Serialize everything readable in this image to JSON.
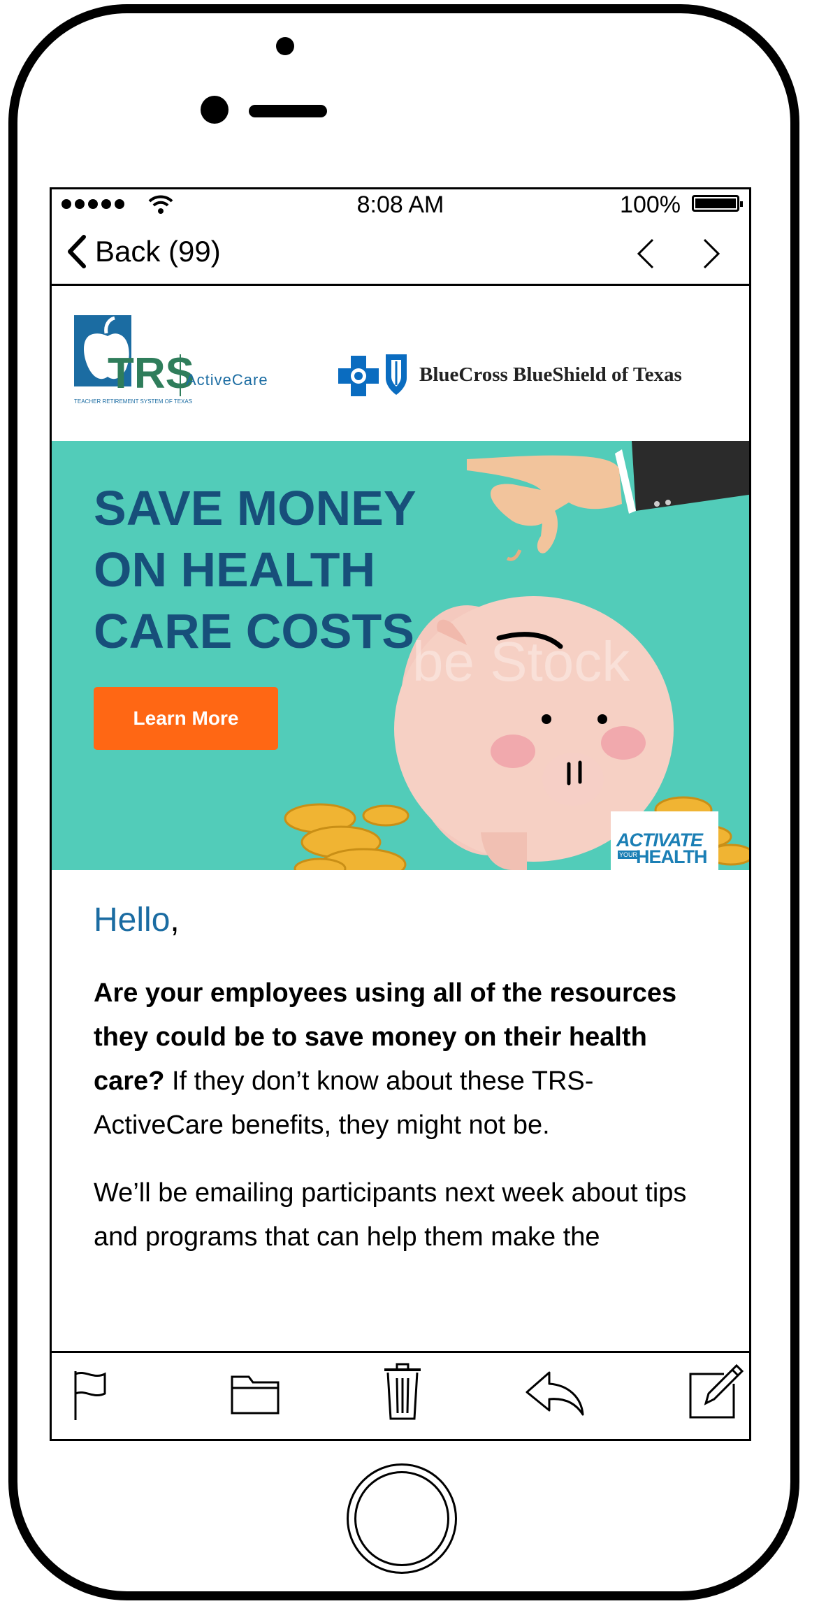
{
  "status_bar": {
    "time": "8:08 AM",
    "battery_percent": "100%",
    "signal_bars": 5
  },
  "nav": {
    "back_label": "Back (99)",
    "prev_icon": "chevron-left-icon",
    "next_icon": "chevron-right-icon"
  },
  "email": {
    "logos": {
      "trs_mark": "TRS",
      "trs_product": "ActiveCare",
      "trs_tagline": "TEACHER RETIREMENT SYSTEM OF TEXAS",
      "partner_name": "BlueCross BlueShield of Texas"
    },
    "banner": {
      "headline_lines": [
        "SAVE MONEY",
        "ON HEALTH",
        "CARE COSTS"
      ],
      "cta_label": "Learn More",
      "watermark": "be Stock",
      "badge_line1": "ACTIVATE",
      "badge_your": "YOUR",
      "badge_line2": "HEALTH",
      "colors": {
        "background": "#52ccb9",
        "headline": "#174f7a",
        "cta": "#ff6714"
      }
    },
    "greeting": "Hello",
    "greeting_punct": ",",
    "para1_bold": "Are your employees using all of the resources they could be to save money on their health care?",
    "para1_rest": " If they don’t know about these TRS-ActiveCare benefits, they might not be.",
    "para2": "We’ll be emailing participants next week about tips and programs that can help them make the"
  },
  "toolbar": {
    "icons": [
      "flag-icon",
      "folder-icon",
      "trash-icon",
      "reply-icon",
      "compose-icon"
    ]
  }
}
